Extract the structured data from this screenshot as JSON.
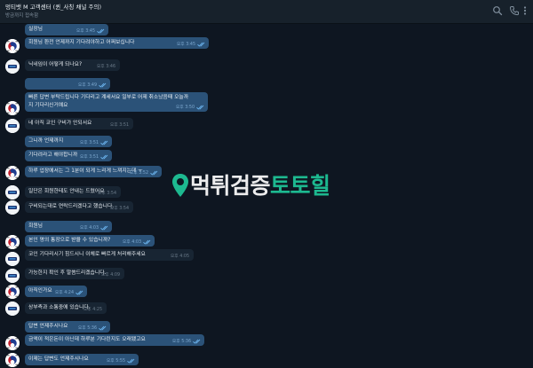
{
  "header": {
    "title": "멍티뱃 M 고객센터 (퀸_사칭 채널 주의)",
    "status": "방금까지 접속함"
  },
  "messages": [
    {
      "dir": "out",
      "text": "실장님",
      "time": "오후 3:45",
      "read": true
    },
    {
      "dir": "out",
      "text": "회원님 환전 언제까지 기다려야하고 어쩌보십니다",
      "time": "오후 3:45",
      "read": true
    },
    {
      "dir": "in",
      "text": "닉네임이 어떻게 되나요?",
      "time": "오후 3:46"
    },
    {
      "dir": "out",
      "text": "",
      "time": "오후 3:49",
      "read": true
    },
    {
      "dir": "out",
      "text": "빠른 답변 부탁드립니다 기다리고 계세서요 일부로 어제 취소났음때 오늘까지 기다리신거예요",
      "time": "오후 3:50",
      "read": true
    },
    {
      "dir": "in",
      "text": "네 아직 코인 구비가 안되서요",
      "time": "오후 3:51"
    },
    {
      "dir": "out",
      "text": "그니까 언제까지",
      "time": "오후 3:51",
      "read": true
    },
    {
      "dir": "out",
      "text": "기다려라고 해야합니까",
      "time": "오후 3:51",
      "read": true
    },
    {
      "dir": "out",
      "text": "하루 업장에서는 그 1분이 되게 느리게 느껴지는데 ㅜ",
      "time": "오후 3:52",
      "read": true
    },
    {
      "dir": "in",
      "text": "일단은 회원한테도 안내는 드렸어요",
      "time": "오후 3:54"
    },
    {
      "dir": "in",
      "text": "구비되는대로 연락드리겠다고 했습니다.",
      "time": "오후 3:54"
    },
    {
      "dir": "out",
      "text": "회원님",
      "time": "오후 4:03",
      "read": true
    },
    {
      "dir": "out",
      "text": "본인 명의 통장으로 받을 수 있습니까?",
      "time": "오후 4:03",
      "read": true
    },
    {
      "dir": "in",
      "text": "코인 기다리시기 힘드시니 이체로 빠르게 처리해주세요",
      "time": "오후 4:05"
    },
    {
      "dir": "in",
      "text": "가능한지 확인 후 말씀드리겠습니다.",
      "time": "오후 4:09"
    },
    {
      "dir": "out",
      "text": "아직인가요",
      "time": "오후 4:24",
      "read": true
    },
    {
      "dir": "in",
      "text": "상부측과 소통중에 있습니다.",
      "time": "오후 4:25"
    },
    {
      "dir": "out",
      "text": "답변 언제주시나요",
      "time": "오후 5:36",
      "read": true
    },
    {
      "dir": "out",
      "text": "금액이 적은돈이 아닌데 하루분 기다린지도 오래됐고요",
      "time": "오후 5:36",
      "read": true
    },
    {
      "dir": "out",
      "text": "이제는 답변도 언제주시나요",
      "time": "오후 5:55",
      "read": true
    }
  ],
  "watermark": {
    "part1": "먹튀검증",
    "part2": "토토힐",
    "color1": "#ffffff",
    "color2": "#1fc79a"
  },
  "icons": [
    "search-icon",
    "phone-icon",
    "more-icon",
    "avatar-flag-icon",
    "avatar-logo-icon",
    "double-check-icon",
    "location-pin-icon"
  ]
}
